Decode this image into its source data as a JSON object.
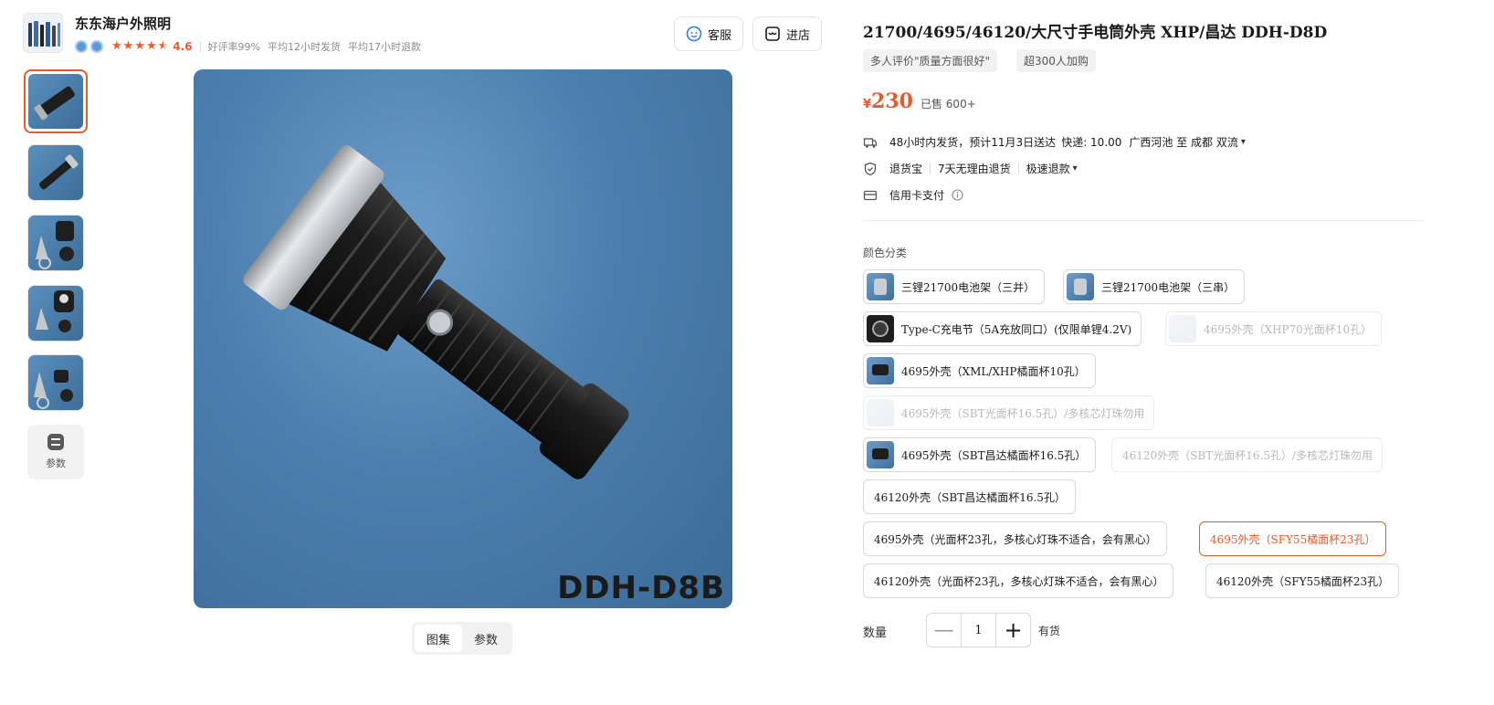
{
  "shop": {
    "name": "东东海户外照明",
    "rating": "4.6",
    "positive_rate": "好评率99%",
    "avg_ship": "平均12小时发货",
    "avg_refund": "平均17小时退款",
    "stars_filled": 4.5
  },
  "header_buttons": {
    "service": "客服",
    "enter_shop": "进店"
  },
  "gallery": {
    "params_label": "参数",
    "watermark": "DDH-D8B",
    "tabs": [
      "图集",
      "参数"
    ],
    "active_tab": 0
  },
  "product": {
    "title": "21700/4695/46120/大尺寸手电筒外壳 XHP/昌达 DDH-D8D",
    "tags": [
      "多人评价\"质量方面很好\"",
      "超300人加购"
    ],
    "price_currency": "¥",
    "price": "230",
    "sold": "已售 600+"
  },
  "delivery": {
    "ship_time": "48小时内发货，预计11月3日送达",
    "express": "快递: 10.00",
    "route": "广西河池 至 成都 双流"
  },
  "service": {
    "return_insurance": "退货宝",
    "no_reason": "7天无理由退货",
    "fast_refund": "极速退款"
  },
  "payment": {
    "credit": "信用卡支付"
  },
  "variants": {
    "label": "颜色分类",
    "options": [
      {
        "label": "三锂21700电池架（三并）",
        "state": "normal"
      },
      {
        "label": "三锂21700电池架（三串）",
        "state": "normal"
      },
      {
        "label": "Type-C充电节（5A充放同口）(仅限单锂4.2V)",
        "state": "normal"
      },
      {
        "label": "4695外壳（XHP70光面杯10孔）",
        "state": "disabled"
      },
      {
        "label": "4695外壳（XML/XHP橘面杯10孔）",
        "state": "normal"
      },
      {
        "label": "4695外壳（SBT光面杯16.5孔）/多核芯灯珠勿用",
        "state": "disabled"
      },
      {
        "label": "4695外壳（SBT昌达橘面杯16.5孔）",
        "state": "normal"
      },
      {
        "label": "46120外壳（SBT光面杯16.5孔）/多核芯灯珠勿用",
        "state": "disabled"
      },
      {
        "label": "46120外壳（SBT昌达橘面杯16.5孔）",
        "state": "normal"
      },
      {
        "label": "4695外壳（光面杯23孔，多核心灯珠不适合，会有黑心）",
        "state": "normal"
      },
      {
        "label": "4695外壳（SFY55橘面杯23孔）",
        "state": "selected"
      },
      {
        "label": "46120外壳（光面杯23孔，多核心灯珠不适合，会有黑心）",
        "state": "normal"
      },
      {
        "label": "46120外壳（SFY55橘面杯23孔）",
        "state": "normal"
      }
    ]
  },
  "quantity": {
    "label": "数量",
    "value": "1",
    "minus": "—",
    "plus": "+",
    "stock": "有货"
  },
  "colors": {
    "accent": "#e75a2a",
    "image_bg": "#4d7fae"
  }
}
